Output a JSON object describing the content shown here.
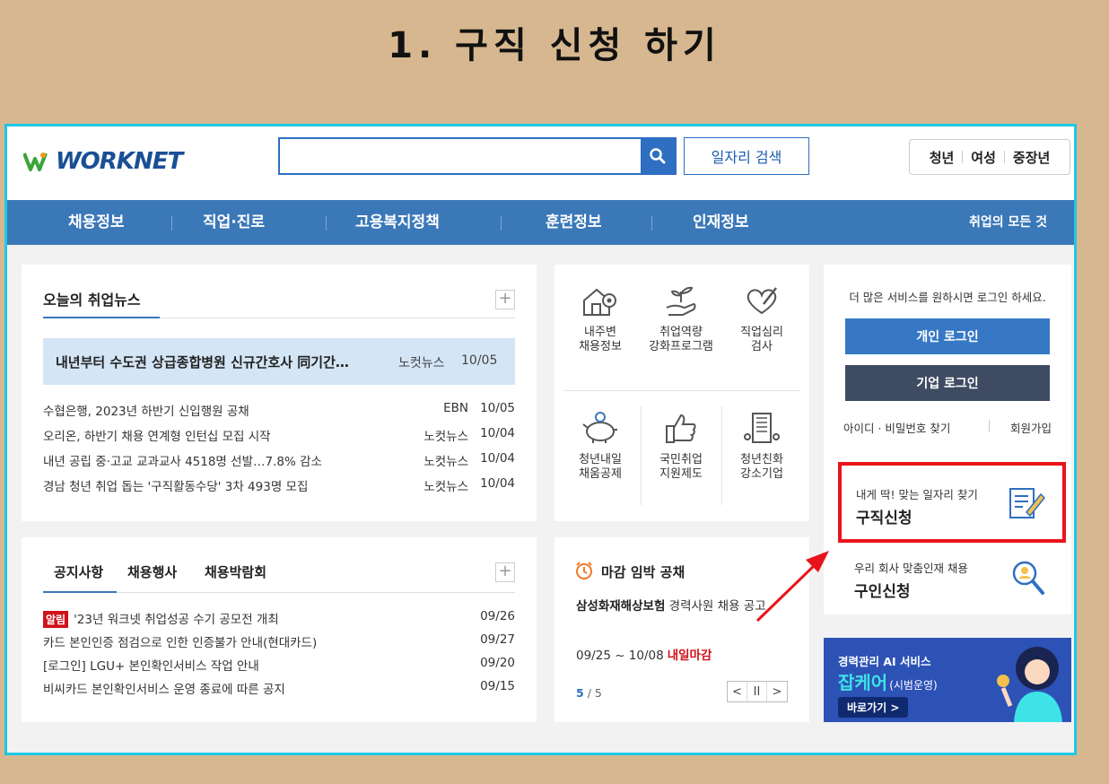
{
  "slide_title": "1. 구직 신청 하기",
  "header": {
    "logo": "WORKNET",
    "search_placeholder": "",
    "job_search_button": "일자리 검색",
    "age_tabs": [
      "청년",
      "여성",
      "중장년"
    ]
  },
  "gnb": {
    "items": [
      "채용정보",
      "직업·진로",
      "고용복지정책",
      "훈련정보",
      "인재정보"
    ],
    "right": "취업의 모든 것"
  },
  "news": {
    "title": "오늘의 취업뉴스",
    "headline": {
      "text": "내년부터 수도권 상급종합병원 신규간호사 同기간…",
      "source": "노컷뉴스",
      "date": "10/05"
    },
    "rows": [
      {
        "text": "수협은행, 2023년 하반기 신입행원 공채",
        "source": "EBN",
        "date": "10/05"
      },
      {
        "text": "오리온, 하반기 채용 연계형 인턴십 모집 시작",
        "source": "노컷뉴스",
        "date": "10/04"
      },
      {
        "text": "내년 공립 중·고교 교과교사 4518명 선발…7.8% 감소",
        "source": "노컷뉴스",
        "date": "10/04"
      },
      {
        "text": "경남 청년 취업 돕는 '구직활동수당' 3차 493명 모집",
        "source": "노컷뉴스",
        "date": "10/04"
      }
    ]
  },
  "services": [
    {
      "line1": "내주변",
      "line2": "채용정보",
      "icon": "house-pin-icon"
    },
    {
      "line1": "취업역량",
      "line2": "강화프로그램",
      "icon": "sprout-hand-icon"
    },
    {
      "line1": "직업심리",
      "line2": "검사",
      "icon": "heart-pen-icon"
    },
    {
      "line1": "청년내일",
      "line2": "채움공제",
      "icon": "piggy-bank-icon"
    },
    {
      "line1": "국민취업",
      "line2": "지원제도",
      "icon": "thumbs-up-icon"
    },
    {
      "line1": "청년친화",
      "line2": "강소기업",
      "icon": "building-icon"
    }
  ],
  "login": {
    "hint": "더 많은 서비스를 원하시면 로그인 하세요.",
    "personal": "개인 로그인",
    "company": "기업 로그인",
    "find": "아이디 · 비밀번호 찾기",
    "join": "회원가입",
    "apply_sub": "내게 딱! 맞는 일자리 찾기",
    "apply_title": "구직신청",
    "hire_sub": "우리 회사 맞춤인재 채용",
    "hire_title": "구인신청"
  },
  "notice": {
    "tabs": [
      "공지사항",
      "채용행사",
      "채용박람회"
    ],
    "rows": [
      {
        "badge": "알림",
        "text": "'23년 워크넷 취업성공 수기 공모전 개최",
        "date": "09/26"
      },
      {
        "badge": "",
        "text": "카드 본인인증 점검으로 인한 인증불가 안내(현대카드)",
        "date": "09/27"
      },
      {
        "badge": "",
        "text": "[로그인] LGU+ 본인확인서비스 작업 안내",
        "date": "09/20"
      },
      {
        "badge": "",
        "text": "비씨카드 본인확인서비스 운영 종료에 따른 공지",
        "date": "09/15"
      }
    ]
  },
  "deadline": {
    "title": "마감 임박 공채",
    "company": "삼성화재해상보험",
    "job": "경력사원 채용 공고",
    "date": "09/25 ~ 10/08",
    "status": "내일마감",
    "page_current": "5",
    "page_total": "/ 5"
  },
  "banner": {
    "line1": "경력관리 AI 서비스",
    "line2": "잡케어",
    "line2_note": "(시범운영)",
    "button": "바로가기 >"
  },
  "colors": {
    "accent": "#3b78b8",
    "highlight_box": "#e8141b",
    "frame": "#1ec8e6",
    "background": "#d6b78f"
  }
}
